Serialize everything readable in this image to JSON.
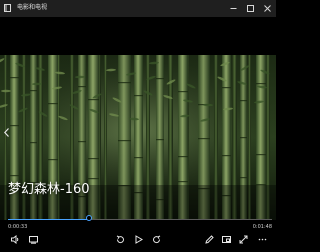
{
  "window": {
    "title": "电影和电视",
    "app_icon": "film-icon",
    "minimize_icon": "minimize-icon",
    "maximize_icon": "maximize-icon",
    "close_icon": "close-icon"
  },
  "video": {
    "title": "梦幻森林-160",
    "scene": "bamboo forest, soft light, deep green tones",
    "colors": {
      "accent": "#4aa3ff",
      "scene_dark": "#15200f",
      "scene_mid": "#3f5a2a",
      "scene_light": "#8fa56a"
    }
  },
  "playback": {
    "current_time": "0:00:33",
    "total_time": "0:01:48",
    "progress": 0.305
  },
  "controls": {
    "left": [
      {
        "name": "volume-button",
        "icon": "speaker-icon"
      },
      {
        "name": "subtitles-button",
        "icon": "captions-icon"
      }
    ],
    "center": [
      {
        "name": "skip-back-button",
        "icon": "rewind-icon"
      },
      {
        "name": "play-button",
        "icon": "play-icon"
      },
      {
        "name": "skip-forward-button",
        "icon": "forward-icon"
      }
    ],
    "right": [
      {
        "name": "edit-button",
        "icon": "pencil-icon"
      },
      {
        "name": "mini-view-button",
        "icon": "picture-in-picture-icon"
      },
      {
        "name": "fullscreen-button",
        "icon": "expand-icon"
      },
      {
        "name": "more-button",
        "icon": "more-icon"
      }
    ]
  },
  "navigation": {
    "prev_icon": "chevron-left-icon"
  }
}
